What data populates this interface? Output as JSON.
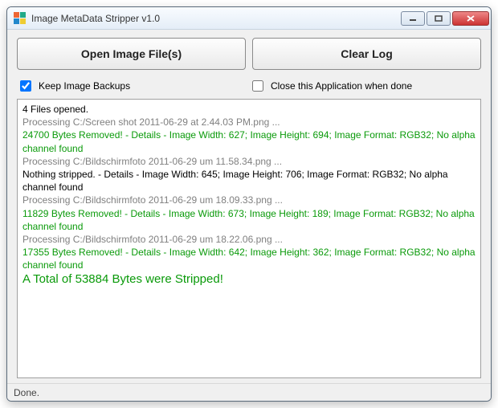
{
  "window": {
    "title": "Image MetaData Stripper v1.0"
  },
  "buttons": {
    "open": "Open Image File(s)",
    "clear": "Clear Log"
  },
  "checks": {
    "keep_backups": "Keep Image Backups",
    "close_when_done": "Close this Application when done"
  },
  "log": {
    "opened": "4 Files opened.",
    "lines": [
      {
        "style": "gray",
        "text": "Processing C:/Screen shot 2011-06-29 at 2.44.03 PM.png ..."
      },
      {
        "style": "green",
        "text": "24700 Bytes Removed! - Details - Image Width: 627; Image Height: 694; Image Format: RGB32; No alpha channel found"
      },
      {
        "style": "gray",
        "text": "Processing C:/Bildschirmfoto 2011-06-29 um 11.58.34.png ..."
      },
      {
        "style": "black",
        "text": "Nothing stripped. - Details - Image Width: 645; Image Height: 706; Image Format: RGB32; No alpha channel found"
      },
      {
        "style": "gray",
        "text": "Processing C:/Bildschirmfoto 2011-06-29 um 18.09.33.png ..."
      },
      {
        "style": "green",
        "text": "11829 Bytes Removed! - Details - Image Width: 673; Image Height: 189; Image Format: RGB32; No alpha channel found"
      },
      {
        "style": "gray",
        "text": "Processing C:/Bildschirmfoto 2011-06-29 um 18.22.06.png ..."
      },
      {
        "style": "green",
        "text": "17355 Bytes Removed! - Details - Image Width: 642; Image Height: 362; Image Format: RGB32; No alpha channel found"
      }
    ],
    "total": "A Total of 53884 Bytes were Stripped!"
  },
  "status": "Done."
}
